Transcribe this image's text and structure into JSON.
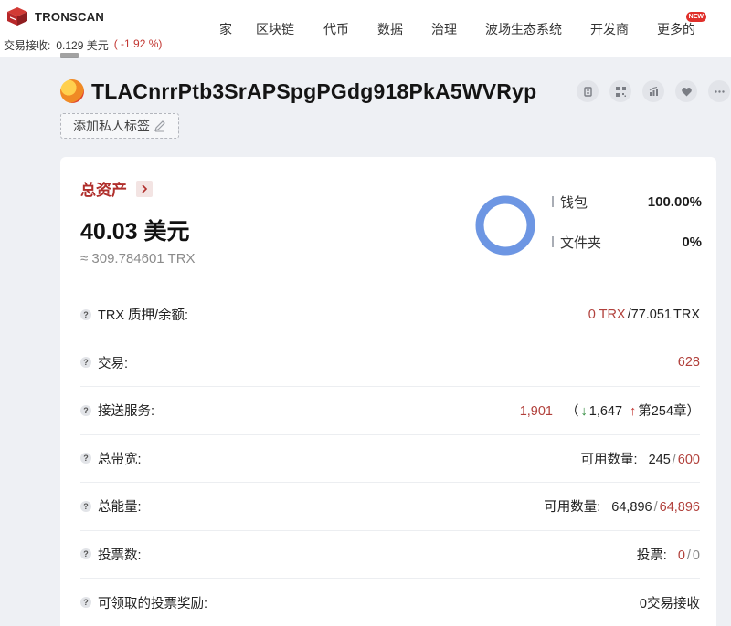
{
  "header": {
    "brand": "TRONSCAN",
    "price_label": "交易接收:",
    "price_value": "0.129 美元",
    "price_change": "( -1.92 %)",
    "nav": [
      "家",
      "区块链",
      "代币",
      "数据",
      "治理",
      "波场生态系统",
      "开发商",
      "更多的"
    ],
    "new_badge": "NEW"
  },
  "address": {
    "value": "TLACnrrPtb3SrAPSpgPGdg918PkA5WVRyp",
    "add_tag_label": "添加私人标签",
    "action_icons": [
      "copy-icon",
      "qrcode-icon",
      "chart-icon",
      "heart-icon",
      "more-icon"
    ]
  },
  "assets": {
    "title": "总资产",
    "usd_total": "40.03 美元",
    "trx_total": "≈ 309.784601 TRX",
    "donut_color": "#6d96e3",
    "legend": [
      {
        "label": "钱包",
        "value": "100.00%",
        "share": 1.0
      },
      {
        "label": "文件夹",
        "value": "0%",
        "share": 0.0
      }
    ]
  },
  "rows": [
    {
      "label": "TRX 质押/余额:",
      "v1": "0 TRX",
      "v2": "/77.051",
      "v3": "TRX"
    },
    {
      "label": "交易:",
      "v1": "628"
    },
    {
      "label": "接送服务:",
      "v1": "1,901",
      "v2": "（",
      "v3": "↓",
      "v4": "1,647",
      "v5": "↑",
      "v6": "第254章）"
    },
    {
      "label": "总带宽:",
      "v1": "可用数量:",
      "v2": "245",
      "v3": "/",
      "v4": "600"
    },
    {
      "label": "总能量:",
      "v1": "可用数量:",
      "v2": "64,896",
      "v3": "/",
      "v4": "64,896"
    },
    {
      "label": "投票数:",
      "v1": "投票:",
      "v2": "0",
      "v3": "/",
      "v4": "0"
    },
    {
      "label": "可领取的投票奖励:",
      "v1": "0交易接收"
    }
  ]
}
